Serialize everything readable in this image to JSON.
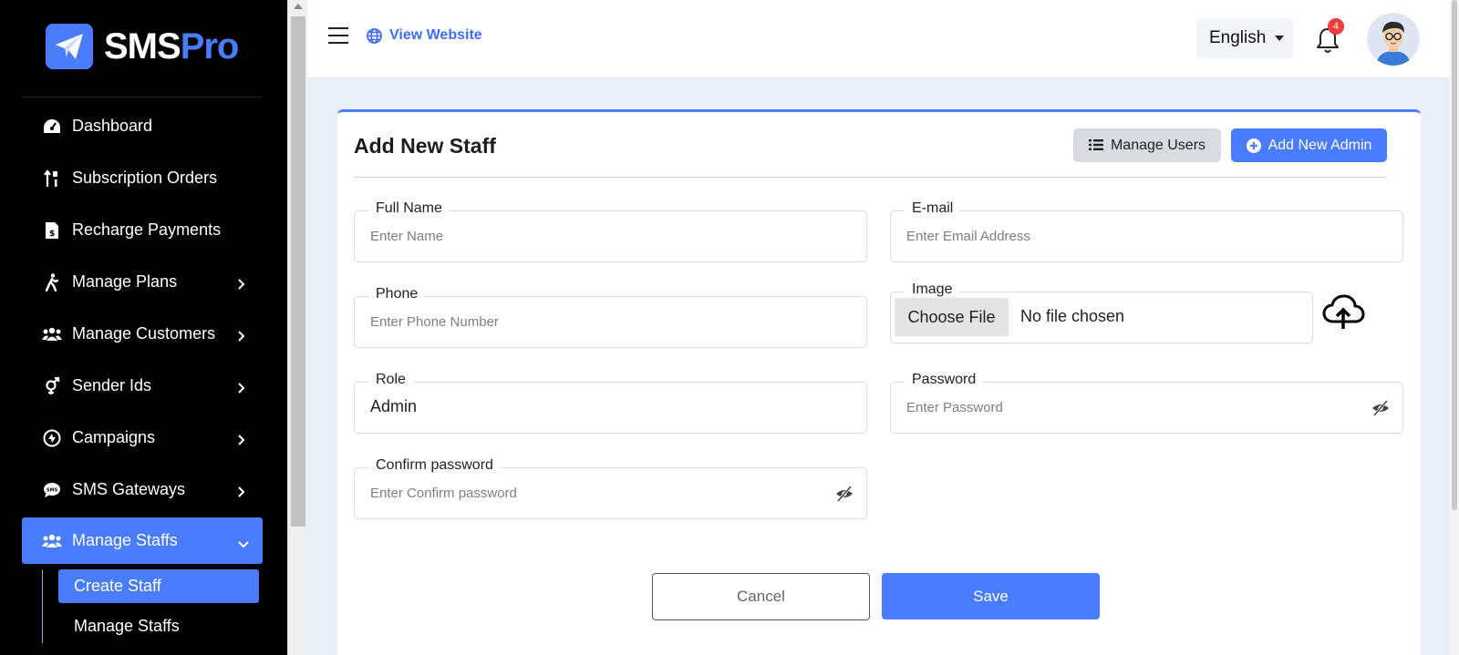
{
  "brand": {
    "name_main": "SMS",
    "name_accent": "Pro"
  },
  "sidebar": {
    "items": [
      {
        "label": "Dashboard",
        "icon": "gauge-icon"
      },
      {
        "label": "Subscription Orders",
        "icon": "sort-icon"
      },
      {
        "label": "Recharge Payments",
        "icon": "invoice-icon"
      },
      {
        "label": "Manage Plans",
        "icon": "walk-icon",
        "has_children": true
      },
      {
        "label": "Manage Customers",
        "icon": "users-icon",
        "has_children": true
      },
      {
        "label": "Sender Ids",
        "icon": "gender-icon",
        "has_children": true
      },
      {
        "label": "Campaigns",
        "icon": "campaign-icon",
        "has_children": true
      },
      {
        "label": "SMS Gateways",
        "icon": "sms-icon",
        "has_children": true
      },
      {
        "label": "Manage Staffs",
        "icon": "staff-icon",
        "active": true,
        "expanded": true
      }
    ],
    "sub_items": [
      {
        "label": "Create Staff",
        "active": true
      },
      {
        "label": "Manage Staffs"
      }
    ]
  },
  "topbar": {
    "view_website": "View Website",
    "language": "English",
    "notification_count": "4"
  },
  "form": {
    "title": "Add New Staff",
    "manage_users_label": "Manage Users",
    "add_admin_label": "Add New Admin",
    "full_name": {
      "label": "Full Name",
      "placeholder": "Enter Name"
    },
    "email": {
      "label": "E-mail",
      "placeholder": "Enter Email Address"
    },
    "phone": {
      "label": "Phone",
      "placeholder": "Enter Phone Number"
    },
    "image": {
      "label": "Image",
      "button": "Choose File",
      "status": "No file chosen"
    },
    "role": {
      "label": "Role",
      "value": "Admin"
    },
    "password": {
      "label": "Password",
      "placeholder": "Enter Password"
    },
    "confirm_password": {
      "label": "Confirm password",
      "placeholder": "Enter Confirm password"
    },
    "cancel_label": "Cancel",
    "save_label": "Save"
  },
  "colors": {
    "accent": "#4a7cff",
    "sidebar_bg": "#000000",
    "content_bg": "#eaeef6",
    "badge": "#f03e3e"
  }
}
